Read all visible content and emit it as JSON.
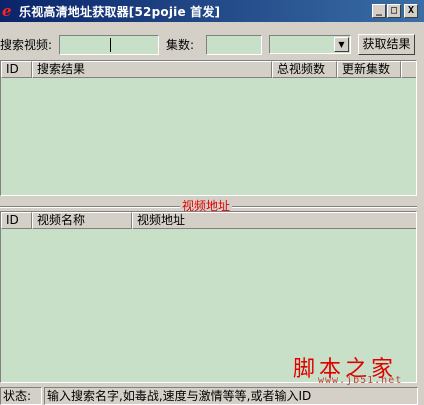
{
  "window": {
    "title": "乐视高清地址获取器[52pojie 首发]",
    "icon_letter": "e",
    "minimize_glyph": "_",
    "maximize_glyph": "□",
    "close_glyph": "X"
  },
  "search": {
    "label": "搜索视频:",
    "value": "",
    "episodes_label": "集数:",
    "episodes_value": "",
    "dropdown_selected": "",
    "dropdown_arrow": "▼",
    "fetch_button": "获取结果"
  },
  "results_table": {
    "columns": [
      "ID",
      "搜索结果",
      "总视频数",
      "更新集数"
    ],
    "rows": []
  },
  "splitter": {
    "label": "视频地址"
  },
  "address_table": {
    "columns": [
      "ID",
      "视频名称",
      "视频地址"
    ],
    "rows": []
  },
  "watermark": {
    "main": "脚本之家",
    "sub": "www.jb51.net"
  },
  "status": {
    "label": "状态:",
    "message": "输入搜索名字,如毒战,速度与激情等等,或者输入ID"
  },
  "colors": {
    "list_background": "#c8e0c8",
    "titlebar_start": "#0a246a",
    "titlebar_end": "#3a6ea5",
    "accent_red": "#e00000"
  }
}
